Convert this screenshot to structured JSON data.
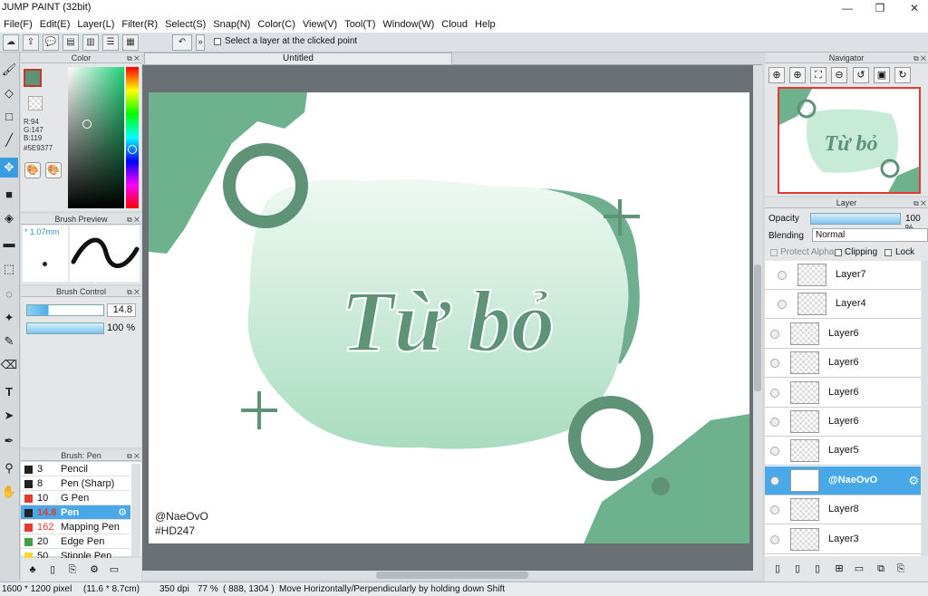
{
  "window": {
    "title": "JUMP PAINT (32bit)"
  },
  "menu": [
    "File(F)",
    "Edit(E)",
    "Layer(L)",
    "Filter(R)",
    "Select(S)",
    "Snap(N)",
    "Color(C)",
    "View(V)",
    "Tool(T)",
    "Window(W)",
    "Cloud",
    "Help"
  ],
  "toolbar": {
    "option_label": "Select a layer at the clicked point"
  },
  "color_panel": {
    "title": "Color",
    "r": "R:94",
    "g": "G:147",
    "b": "B:119",
    "hex": "#5E9377",
    "current_color": "#5E9377"
  },
  "brush_preview": {
    "title": "Brush Preview",
    "size": "* 1.07mm"
  },
  "brush_control": {
    "title": "Brush Control",
    "size_value": "14.8",
    "opacity_value": "100 %"
  },
  "brush_list": {
    "title": "Brush: Pen",
    "items": [
      {
        "size": "3",
        "name": "Pencil",
        "color": "#222222"
      },
      {
        "size": "8",
        "name": "Pen (Sharp)",
        "color": "#222222"
      },
      {
        "size": "10",
        "name": "G Pen",
        "color": "#e53935"
      },
      {
        "size": "14.8",
        "name": "Pen",
        "color": "#222222"
      },
      {
        "size": "162",
        "name": "Mapping Pen",
        "color": "#e53935"
      },
      {
        "size": "20",
        "name": "Edge Pen",
        "color": "#43a047"
      },
      {
        "size": "50",
        "name": "Stipple Pen",
        "color": "#fdd835"
      }
    ]
  },
  "document": {
    "tab_title": "Untitled",
    "title_text": "Từ bỏ",
    "credit_line1": "@NaeOvO",
    "credit_line2": "#HD247"
  },
  "navigator": {
    "title": "Navigator",
    "preview_text": "Từ bỏ"
  },
  "layer_panel": {
    "title": "Layer",
    "opacity_label": "Opacity",
    "opacity_value": "100 %",
    "blending_label": "Blending",
    "blending_value": "Normal",
    "protect_alpha": "Protect Alpha",
    "clipping": "Clipping",
    "lock": "Lock",
    "layers": [
      "Layer7",
      "Layer4",
      "Layer6",
      "Layer6",
      "Layer6",
      "Layer6",
      "Layer5",
      "@NaeOvO",
      "Layer8",
      "Layer3"
    ]
  },
  "status": {
    "size": "1600 * 1200 pixel",
    "physical": "(11.6 * 8.7cm)",
    "dpi": "350 dpi",
    "zoom": "77 %",
    "coords": "( 888, 1304 )",
    "hint": "Move Horizontally/Perpendicularly by holding down Shift"
  }
}
